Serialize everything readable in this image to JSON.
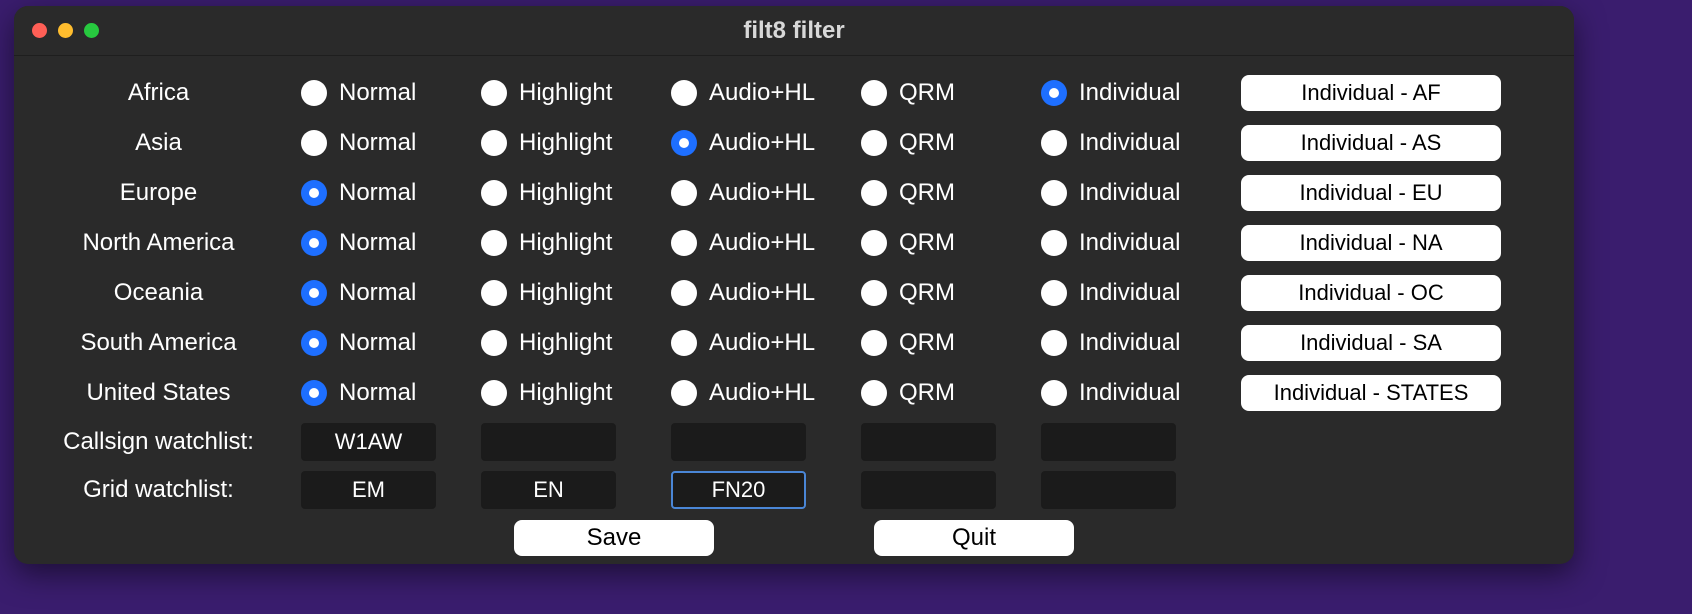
{
  "window": {
    "title": "filt8 filter"
  },
  "options": {
    "normal": "Normal",
    "highlight": "Highlight",
    "audiohl": "Audio+HL",
    "qrm": "QRM",
    "individual": "Individual"
  },
  "regions": [
    {
      "label": "Africa",
      "selected": "individual",
      "button": "Individual - AF"
    },
    {
      "label": "Asia",
      "selected": "audiohl",
      "button": "Individual - AS"
    },
    {
      "label": "Europe",
      "selected": "normal",
      "button": "Individual - EU"
    },
    {
      "label": "North America",
      "selected": "normal",
      "button": "Individual - NA"
    },
    {
      "label": "Oceania",
      "selected": "normal",
      "button": "Individual - OC"
    },
    {
      "label": "South America",
      "selected": "normal",
      "button": "Individual - SA"
    },
    {
      "label": "United States",
      "selected": "normal",
      "button": "Individual - STATES"
    }
  ],
  "watch": {
    "callsign": {
      "label": "Callsign watchlist:",
      "values": [
        "W1AW",
        "",
        "",
        "",
        ""
      ]
    },
    "grid": {
      "label": "Grid watchlist:",
      "values": [
        "EM",
        "EN",
        "FN20",
        "",
        ""
      ],
      "focused_index": 2
    }
  },
  "buttons": {
    "save": "Save",
    "quit": "Quit"
  }
}
